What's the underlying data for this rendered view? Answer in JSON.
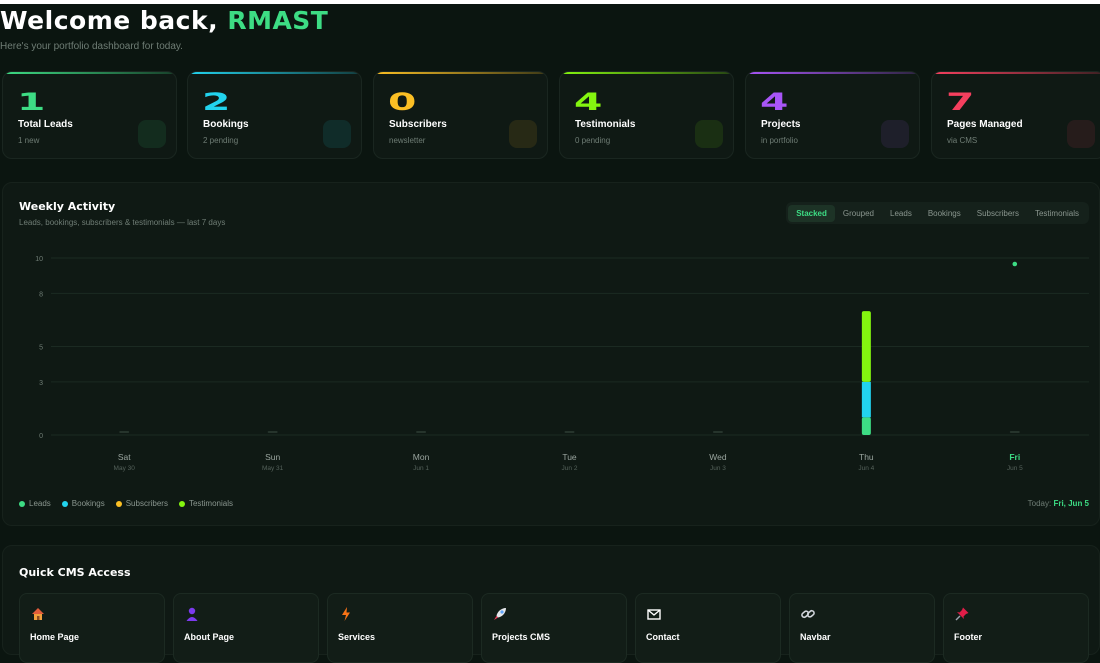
{
  "header": {
    "welcome_prefix": "Welcome back, ",
    "user_name": "RMAST",
    "subtitle": "Here's your portfolio dashboard for today."
  },
  "stats": [
    {
      "value": "1",
      "label": "Total Leads",
      "sub": "1 new",
      "color": "#3ddc84"
    },
    {
      "value": "2",
      "label": "Bookings",
      "sub": "2 pending",
      "color": "#22d3ee"
    },
    {
      "value": "0",
      "label": "Subscribers",
      "sub": "newsletter",
      "color": "#fbbf24"
    },
    {
      "value": "4",
      "label": "Testimonials",
      "sub": "0 pending",
      "color": "#84f50f"
    },
    {
      "value": "4",
      "label": "Projects",
      "sub": "in portfolio",
      "color": "#a855f7"
    },
    {
      "value": "7",
      "label": "Pages Managed",
      "sub": "via CMS",
      "color": "#f43f5e"
    }
  ],
  "activity": {
    "title": "Weekly Activity",
    "subtitle": "Leads, bookings, subscribers & testimonials — last 7 days",
    "tabs": [
      "Stacked",
      "Grouped",
      "Leads",
      "Bookings",
      "Subscribers",
      "Testimonials"
    ],
    "active_tab": "Stacked",
    "legend": [
      {
        "name": "Leads",
        "color": "#3ddc84"
      },
      {
        "name": "Bookings",
        "color": "#22d3ee"
      },
      {
        "name": "Subscribers",
        "color": "#fbbf24"
      },
      {
        "name": "Testimonials",
        "color": "#84f50f"
      }
    ],
    "today_label": "Today:",
    "today_value": "Fri, Jun 5"
  },
  "chart_data": {
    "type": "bar",
    "stacked": true,
    "categories": [
      "Sat",
      "Sun",
      "Mon",
      "Tue",
      "Wed",
      "Thu",
      "Fri"
    ],
    "category_dates": [
      "May 30",
      "May 31",
      "Jun 1",
      "Jun 2",
      "Jun 3",
      "Jun 4",
      "Jun 5"
    ],
    "highlight_category": "Fri",
    "yticks": [
      "0",
      "3",
      "5",
      "8",
      "10"
    ],
    "ylim": [
      0,
      10
    ],
    "grid": true,
    "series": [
      {
        "name": "Leads",
        "color": "#3ddc84",
        "values": [
          0,
          0,
          0,
          0,
          0,
          1,
          0
        ]
      },
      {
        "name": "Bookings",
        "color": "#22d3ee",
        "values": [
          0,
          0,
          0,
          0,
          0,
          2,
          0
        ]
      },
      {
        "name": "Subscribers",
        "color": "#fbbf24",
        "values": [
          0,
          0,
          0,
          0,
          0,
          0,
          0
        ]
      },
      {
        "name": "Testimonials",
        "color": "#84f50f",
        "values": [
          0,
          0,
          0,
          0,
          0,
          4,
          0
        ]
      }
    ]
  },
  "cms": {
    "title": "Quick CMS Access",
    "items": [
      {
        "label": "Home Page",
        "icon": "house-icon"
      },
      {
        "label": "About Page",
        "icon": "person-icon"
      },
      {
        "label": "Services",
        "icon": "lightning-icon"
      },
      {
        "label": "Projects CMS",
        "icon": "rocket-icon"
      },
      {
        "label": "Contact",
        "icon": "envelope-icon"
      },
      {
        "label": "Navbar",
        "icon": "link-icon"
      },
      {
        "label": "Footer",
        "icon": "pushpin-icon"
      }
    ]
  }
}
